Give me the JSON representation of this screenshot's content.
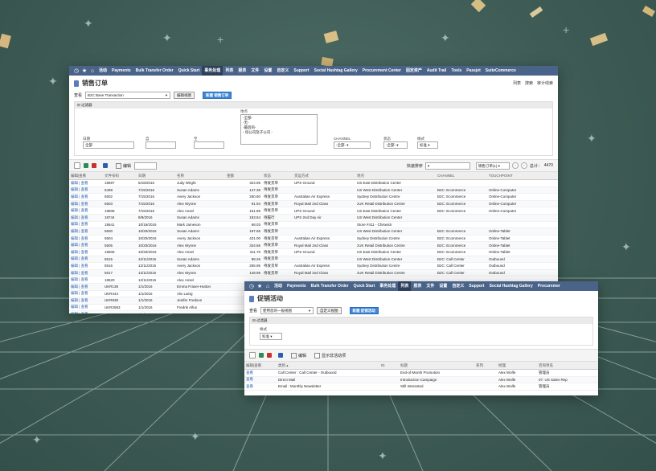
{
  "window1": {
    "nav": [
      "活动",
      "Payments",
      "Bulk Transfer Order",
      "Quick Start",
      "事务处理",
      "列表",
      "报表",
      "文件",
      "设置",
      "自定义",
      "Support",
      "Social Hashtag Gallery",
      "Procurement Center",
      "固定资产",
      "Audit Trail",
      "Tools",
      "Passjet",
      "SuiteCommerce"
    ],
    "nav_active": "事务处理",
    "title": "销售订单",
    "title_links": [
      "列表",
      "搜索",
      "审计线索"
    ],
    "view_label": "查看",
    "view_value": "B2C Base Transaction",
    "edit_view_btn": "编辑视图",
    "new_btn": "新建 销售订单",
    "filter_title": "过滤器",
    "location_label": "地点",
    "location_options": [
      "-全部-",
      "-无-",
      "-最后的-",
      "- 母公司及子公司 -"
    ],
    "date_label": "日期",
    "date_value": "全部",
    "from_label": "自",
    "to_label": "至",
    "channel_label": "CHANNEL",
    "channel_value": "-全部-",
    "status_label": "状态",
    "status_value": "-全部-",
    "style_label": "样式",
    "style_value": "标准",
    "edit_label": "编辑",
    "quick_sort_label": "快速排序",
    "page_info": "销售订单(1)",
    "total_label": "总计：",
    "total_value": "4470",
    "columns": [
      "编辑|查看",
      "文件号码",
      "日期",
      "名称",
      "金额",
      "状态",
      "货运方式",
      "地点",
      "CHANNEL",
      "TOUCHPOINT"
    ],
    "rows": [
      [
        "编辑 | 查看",
        "18697",
        "5/18/2016",
        "Judy Wright",
        "324.95",
        "待发货单",
        "UPS Ground",
        "US East Distribution Center",
        "",
        ""
      ],
      [
        "编辑 | 查看",
        "6499",
        "7/15/2016",
        "Susan Adams",
        "147.38",
        "待发货单",
        "",
        "US West Distribution Center",
        "B2C: Ecommerce",
        "Online-Computer"
      ],
      [
        "编辑 | 查看",
        "5502",
        "7/15/2016",
        "Avery Jackson",
        "250.80",
        "待发货单",
        "Australian Air Express",
        "Sydney Distribution Centre",
        "B2C: Ecommerce",
        "Online-Computer"
      ],
      [
        "编辑 | 查看",
        "6503",
        "7/15/2016",
        "Alex Wynne",
        "91.94",
        "待发货单",
        "Royal Mail 2nd Class",
        "zUK Retail Distribution Centre",
        "B2C: Ecommerce",
        "Online-Computer"
      ],
      [
        "编辑 | 查看",
        "18508",
        "7/15/2016",
        "Alex Ansel",
        "151.89",
        "待发货单",
        "UPS Ground",
        "US East Distribution Center",
        "B2C: Ecommerce",
        "Online-Computer"
      ],
      [
        "编辑 | 查看",
        "18744",
        "8/9/2016",
        "Susan Adams",
        "153.54",
        "待履行",
        "UPS 2nd Day Air",
        "US West Distribution Center",
        "",
        ""
      ],
      [
        "编辑 | 查看",
        "18641",
        "10/16/2016",
        "Mark Jameson",
        "68.03",
        "待发货单",
        "",
        "Store #411 - Chiswick",
        "",
        ""
      ],
      [
        "编辑 | 查看",
        "5500",
        "10/20/2016",
        "Susan Adams",
        "197.66",
        "待发货单",
        "",
        "US West Distribution Center",
        "B2C: Ecommerce",
        "Online-Tablet"
      ],
      [
        "编辑 | 查看",
        "5504",
        "10/20/2016",
        "Avery Jackson",
        "421.00",
        "待发货单",
        "Australian Air Express",
        "Sydney Distribution Centre",
        "B2C: Ecommerce",
        "Online-Tablet"
      ],
      [
        "编辑 | 查看",
        "5505",
        "10/20/2016",
        "Alex Wynne",
        "334.66",
        "待发货单",
        "Royal Mail 2nd Class",
        "zUK Retail Distribution Centre",
        "B2C: Ecommerce",
        "Online-Tablet"
      ],
      [
        "编辑 | 查看",
        "18506",
        "10/20/2016",
        "Alex Ansel",
        "311.76",
        "待发货单",
        "UPS Ground",
        "US East Distribution Center",
        "B2C: Ecommerce",
        "Online-Tablet"
      ],
      [
        "编辑 | 查看",
        "5515",
        "12/11/2015",
        "Susan Adams",
        "88.26",
        "待发货单",
        "",
        "US West Distribution Center",
        "B2C: Call Center",
        "Outbound"
      ],
      [
        "编辑 | 查看",
        "5516",
        "12/11/2015",
        "Avery Jackson",
        "255.95",
        "待发货单",
        "Australian Air Express",
        "Sydney Distribution Centre",
        "B2C: Call Center",
        "Outbound"
      ],
      [
        "编辑 | 查看",
        "5517",
        "12/11/2015",
        "Alex Wynne",
        "148.95",
        "待发货单",
        "Royal Mail 2nd Class",
        "zUK Retail Distribution Centre",
        "B2C: Call Center",
        "Outbound"
      ],
      [
        "编辑 | 查看",
        "18520",
        "12/11/2015",
        "Alex Ansel",
        "",
        "",
        "",
        "",
        "",
        ""
      ],
      [
        "编辑 | 查看",
        "UKR138",
        "1/1/2016",
        "Emma Fraser-Hutton",
        "",
        "",
        "",
        "",
        "",
        ""
      ],
      [
        "编辑 | 查看",
        "UKR444",
        "1/1/2016",
        "Alix Laing",
        "",
        "",
        "",
        "",
        "",
        ""
      ],
      [
        "编辑 | 查看",
        "UKR938",
        "1/1/2016",
        "Jenifer Fredson",
        "",
        "",
        "",
        "",
        "",
        ""
      ],
      [
        "编辑 | 查看",
        "UKR2583",
        "1/1/2016",
        "Fredrik Alfus",
        "",
        "",
        "",
        "",
        "",
        ""
      ],
      [
        "编辑 | 查看",
        "UKR3722",
        "1/1/2016",
        "Lauren Hermann",
        "",
        "",
        "",
        "",
        "",
        ""
      ],
      [
        "编辑 | 查看",
        "UKR4636",
        "1/1/2016",
        "Lauren Fraser-Hutton",
        "",
        "",
        "",
        "",
        "",
        ""
      ],
      [
        "编辑 | 查看",
        "UKR490",
        "1/2/2016",
        "Yasmin Byrne",
        "",
        "",
        "",
        "",
        "",
        ""
      ]
    ]
  },
  "window2": {
    "nav": [
      "活动",
      "Payments",
      "Bulk Transfer Order",
      "Quick Start",
      "事务处理",
      "列表",
      "报表",
      "文件",
      "设置",
      "自定义",
      "Support",
      "Social Hashtag Gallery",
      "Procuremer"
    ],
    "nav_active": "列表",
    "title": "促销活动",
    "view_label": "查看",
    "view_value": "使用您的一般视图",
    "custom_view_btn": "自定义视图",
    "new_btn": "新建 促销活动",
    "filter_title": "过滤器",
    "style_label": "样式",
    "style_value": "标准",
    "edit_label": "编辑",
    "show_inactive_label": "显示非活动项",
    "columns": [
      "编辑|查看",
      "类别 ▴",
      "ID",
      "标题",
      "系列",
      "经理",
      "咨询项名"
    ],
    "rows": [
      [
        "查看",
        "Call Center : Call Center - Outbound",
        "",
        "End-of-Month Promotion",
        "",
        "Alex Wolfe",
        "管理员"
      ],
      [
        "查看",
        "Direct Mail",
        "",
        "Introduction Campaign",
        "",
        "Alex Wolfe",
        "07: US Sales Rep"
      ],
      [
        "查看",
        "Email : Monthly Newsletter",
        "",
        "Still Interested",
        "",
        "Alex Wolfe",
        "管理员"
      ]
    ]
  }
}
